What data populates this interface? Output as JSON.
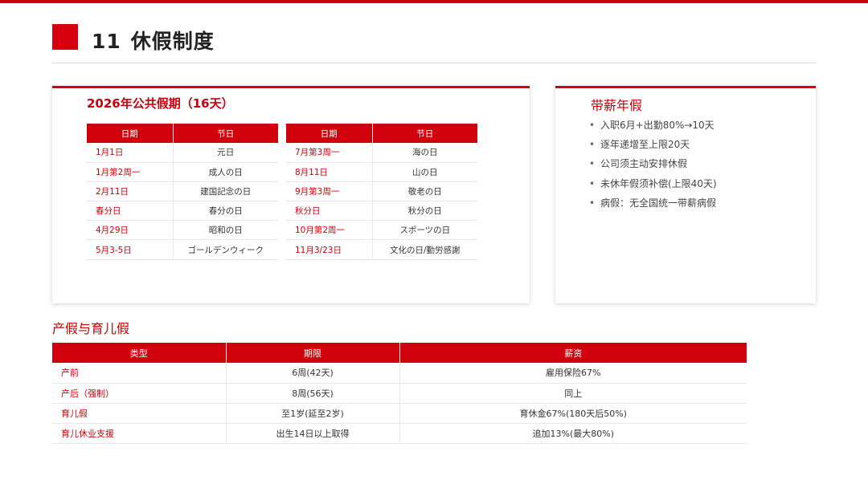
{
  "header": {
    "number": "11",
    "title": "休假制度"
  },
  "holidays": {
    "title": "2026年公共假期（16天）",
    "columns": [
      "日期",
      "节日"
    ],
    "left": [
      {
        "date": "1月1日",
        "name": "元日"
      },
      {
        "date": "1月第2周一",
        "name": "成人の日"
      },
      {
        "date": "2月11日",
        "name": "建国記念の日"
      },
      {
        "date": "春分日",
        "name": "春分の日"
      },
      {
        "date": "4月29日",
        "name": "昭和の日"
      },
      {
        "date": "5月3-5日",
        "name": "ゴールデンウィーク"
      }
    ],
    "right": [
      {
        "date": "7月第3周一",
        "name": "海の日"
      },
      {
        "date": "8月11日",
        "name": "山の日"
      },
      {
        "date": "9月第3周一",
        "name": "敬老の日"
      },
      {
        "date": "秋分日",
        "name": "秋分の日"
      },
      {
        "date": "10月第2周一",
        "name": "スポーツの日"
      },
      {
        "date": "11月3/23日",
        "name": "文化の日/勤労感謝"
      }
    ]
  },
  "paid_leave": {
    "title": "带薪年假",
    "bullet": "•",
    "items": [
      "入职6月+出勤80%→10天",
      "逐年递增至上限20天",
      "公司须主动安排休假",
      "未休年假须补偿(上限40天)",
      "病假：无全国统一带薪病假"
    ]
  },
  "maternity": {
    "title": "产假与育儿假",
    "columns": [
      "类型",
      "期限",
      "薪资"
    ],
    "rows": [
      {
        "type": "产前",
        "period": "6周(42天)",
        "pay": "雇用保险67%"
      },
      {
        "type": "产后（强制）",
        "period": "8周(56天)",
        "pay": "同上"
      },
      {
        "type": "育儿假",
        "period": "至1岁(延至2岁)",
        "pay": "育休金67%(180天后50%)"
      },
      {
        "type": "育儿休业支援",
        "period": "出生14日以上取得",
        "pay": "追加13%(最大80%)"
      }
    ]
  },
  "colors": {
    "accent": "#d7000f",
    "header_fill": "#d0000d"
  }
}
